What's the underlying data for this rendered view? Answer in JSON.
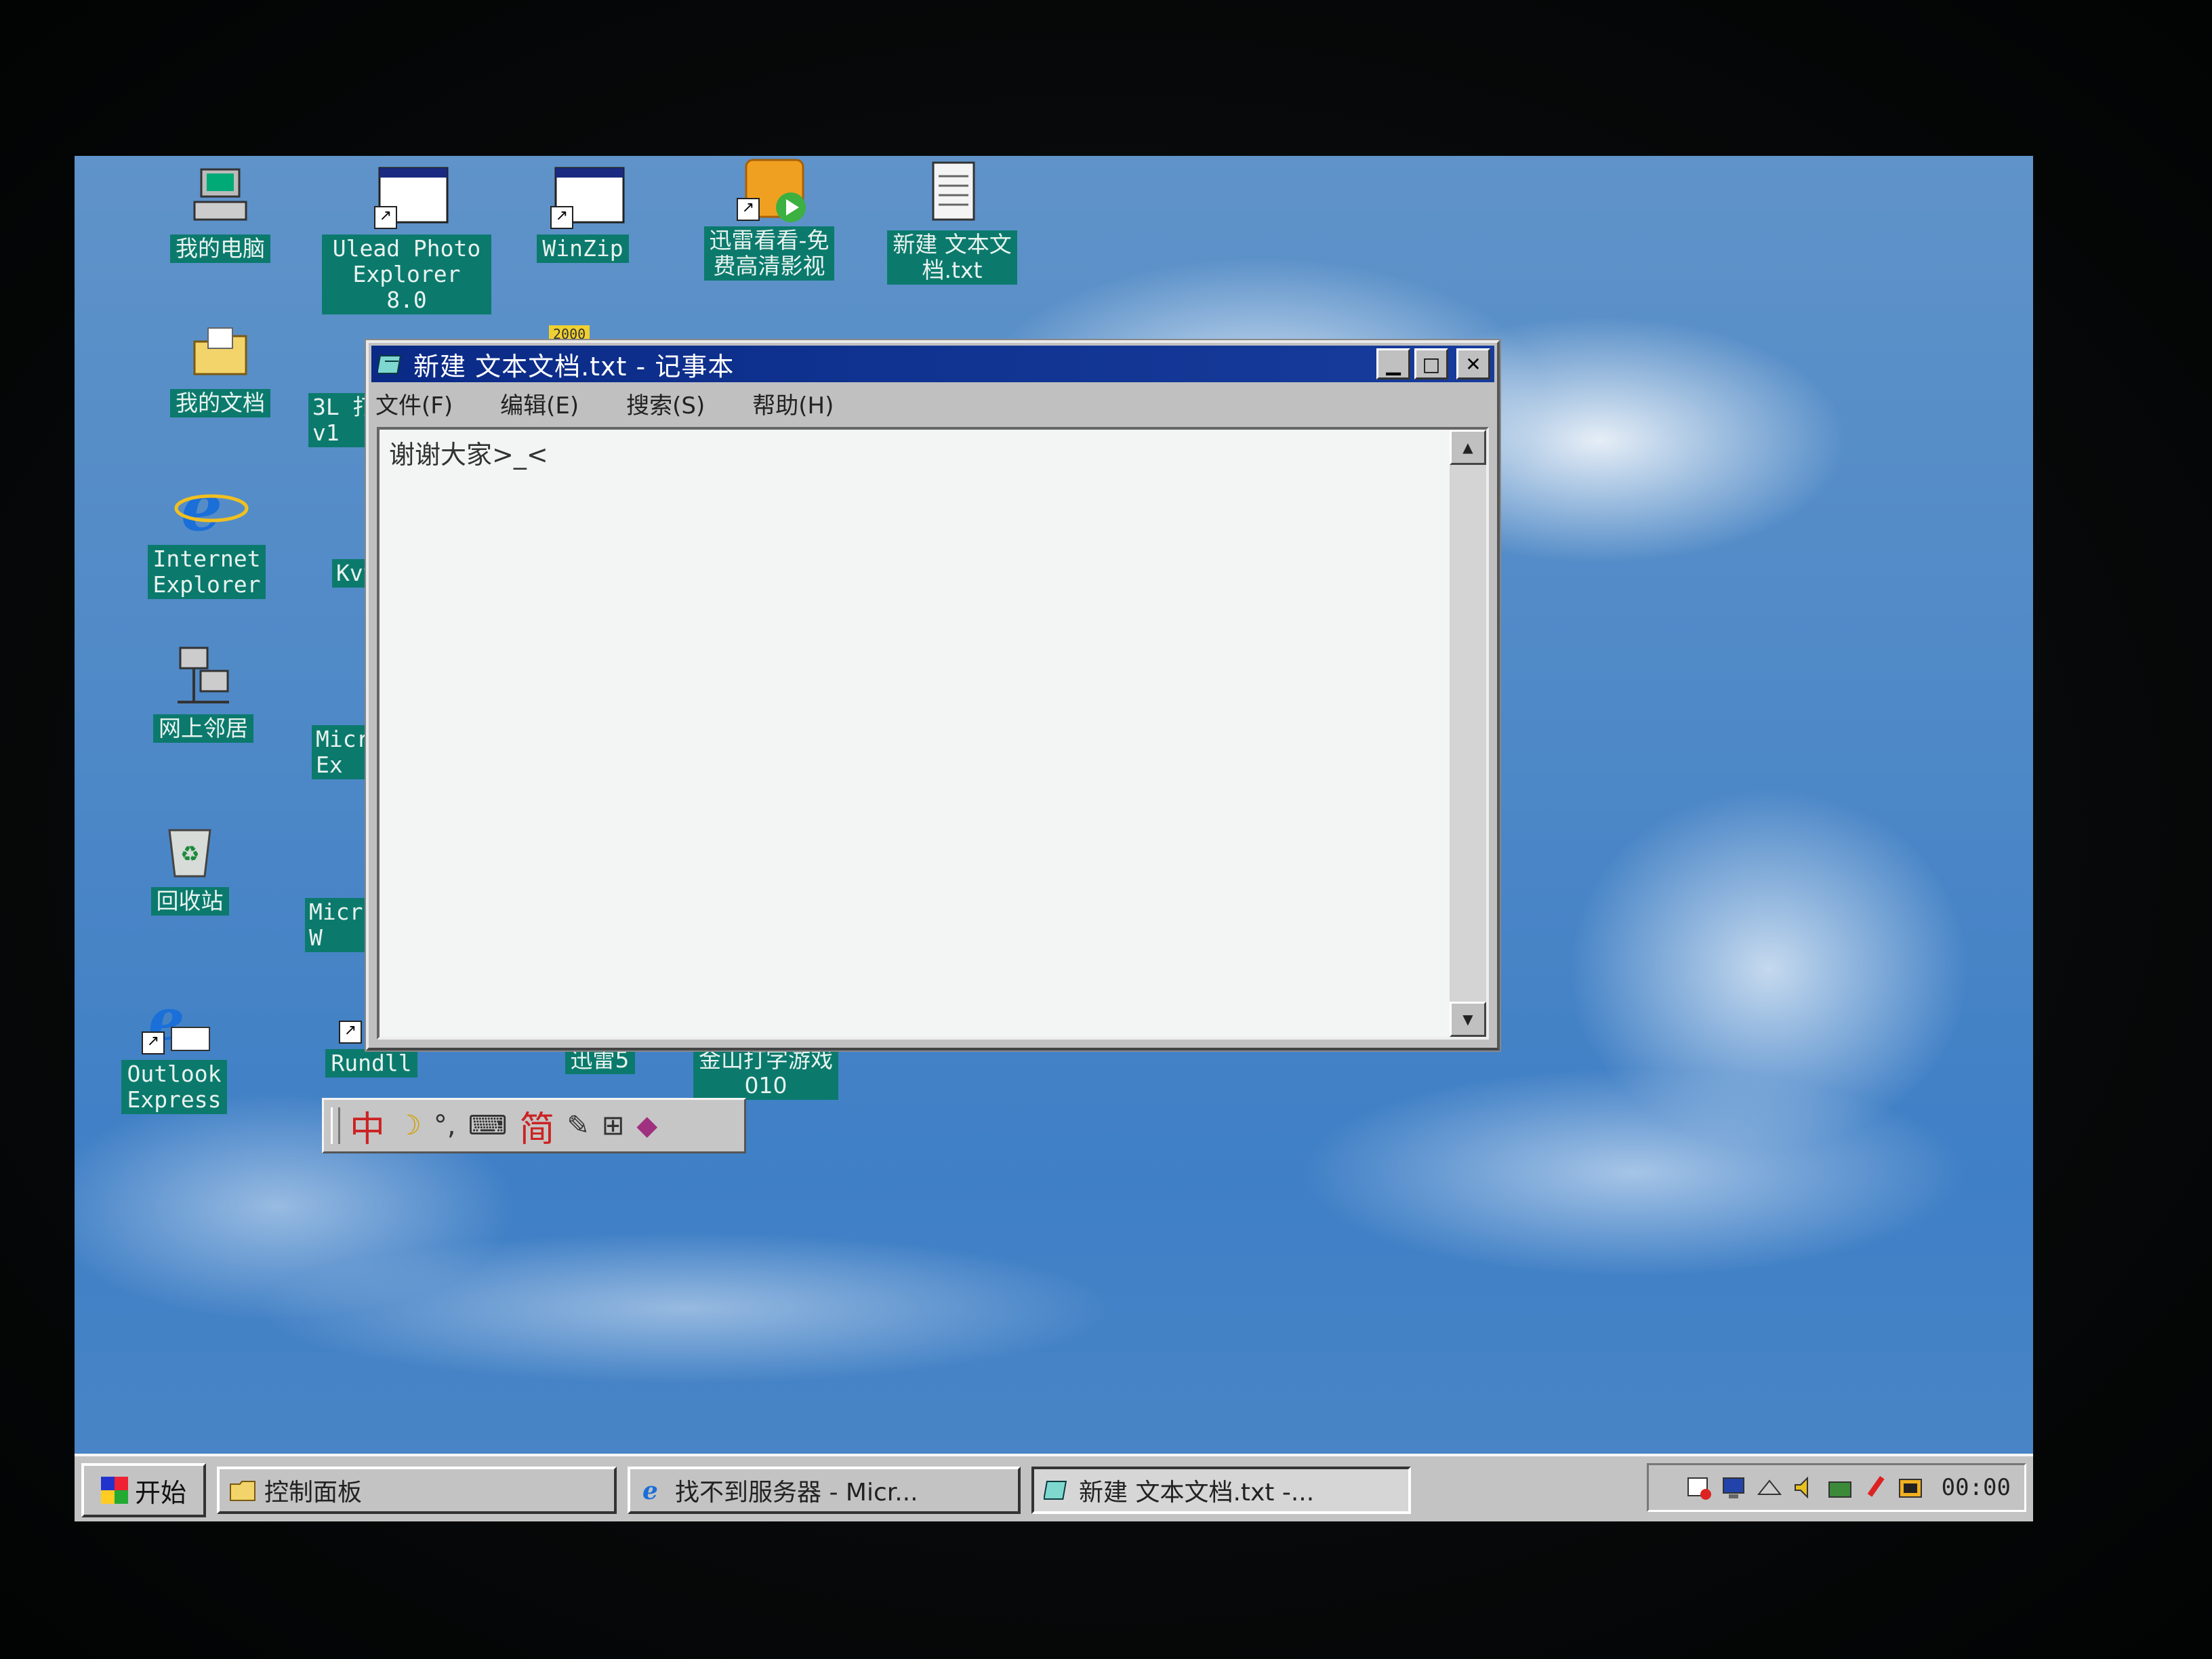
{
  "desktop": {
    "icons": [
      {
        "label": "我的电脑"
      },
      {
        "label": "Ulead Photo\nExplorer 8.0"
      },
      {
        "label": "WinZip"
      },
      {
        "label": "迅雷看看-免\n费高清影视"
      },
      {
        "label": "新建 文本文\n档.txt"
      },
      {
        "label": "我的文档"
      },
      {
        "label": "3L 打\nv1"
      },
      {
        "label": "Internet\nExplorer"
      },
      {
        "label": "Kvv"
      },
      {
        "label": "网上邻居"
      },
      {
        "label": "Micr\nEx"
      },
      {
        "label": "回收站"
      },
      {
        "label": "Micr\nW"
      },
      {
        "label": "Outlook\nExpress"
      },
      {
        "label": "Rundll"
      },
      {
        "label": "迅雷5"
      },
      {
        "label": "金山打字游戏\n010"
      }
    ],
    "icon_small_badge": "2000"
  },
  "notepad": {
    "title": "新建 文本文档.txt - 记事本",
    "menus": [
      "文件(F)",
      "编辑(E)",
      "搜索(S)",
      "帮助(H)"
    ],
    "content": "谢谢大家>_<"
  },
  "ime": {
    "items": [
      "中",
      "简"
    ]
  },
  "taskbar": {
    "start_label": "开始",
    "tasks": [
      {
        "label": "控制面板"
      },
      {
        "label": "找不到服务器 - Micr..."
      },
      {
        "label": "新建 文本文档.txt -..."
      }
    ],
    "clock": "00:00"
  },
  "colors": {
    "desktop_label_bg": "#0b7a6d",
    "titlebar": "#0a2a86",
    "chrome": "#c0c0c0"
  }
}
